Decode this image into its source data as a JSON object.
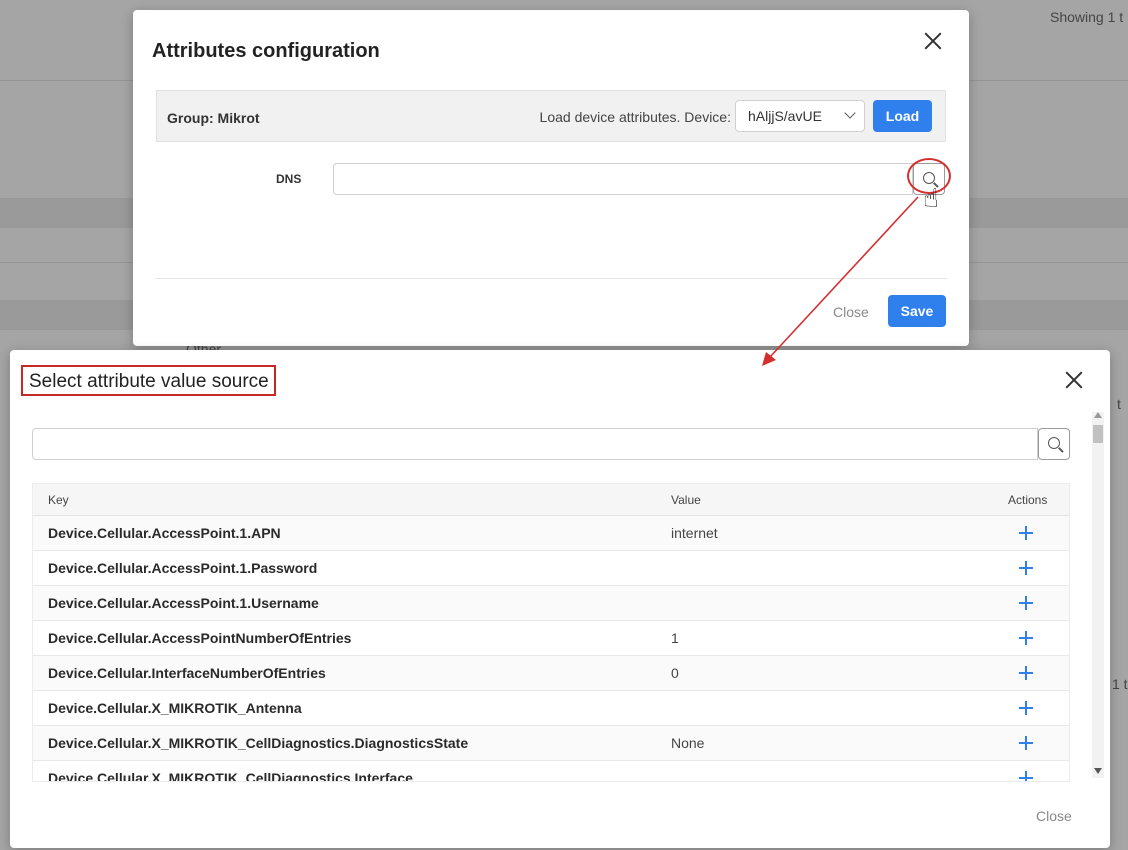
{
  "background": {
    "showing_text": "Showing 1 t",
    "row_text": "Other",
    "right_fragment_1": "t",
    "right_fragment_2": "1 t"
  },
  "attributes_modal": {
    "title": "Attributes configuration",
    "group_label": "Group: Mikrot",
    "load_device_text": "Load device attributes. Device:",
    "device_value": "hAljjS/avUE",
    "load_button": "Load",
    "dns_label": "DNS",
    "dns_value": "",
    "close_button": "Close",
    "save_button": "Save"
  },
  "select_modal": {
    "title": "Select attribute value source",
    "search_value": "",
    "columns": {
      "key": "Key",
      "value": "Value",
      "actions": "Actions"
    },
    "rows": [
      {
        "key": "Device.Cellular.AccessPoint.1.APN",
        "value": "internet"
      },
      {
        "key": "Device.Cellular.AccessPoint.1.Password",
        "value": ""
      },
      {
        "key": "Device.Cellular.AccessPoint.1.Username",
        "value": ""
      },
      {
        "key": "Device.Cellular.AccessPointNumberOfEntries",
        "value": "1"
      },
      {
        "key": "Device.Cellular.InterfaceNumberOfEntries",
        "value": "0"
      },
      {
        "key": "Device.Cellular.X_MIKROTIK_Antenna",
        "value": ""
      },
      {
        "key": "Device.Cellular.X_MIKROTIK_CellDiagnostics.DiagnosticsState",
        "value": "None"
      },
      {
        "key": "Device.Cellular.X_MIKROTIK_CellDiagnostics.Interface",
        "value": ""
      }
    ],
    "close_button": "Close"
  },
  "colors": {
    "primary": "#2f80ed",
    "highlight_red": "#d32f2f"
  },
  "icons": [
    "close-icon",
    "chevron-down-icon",
    "search-icon",
    "hand-pointer-icon",
    "plus-icon",
    "arrow-annotation"
  ]
}
